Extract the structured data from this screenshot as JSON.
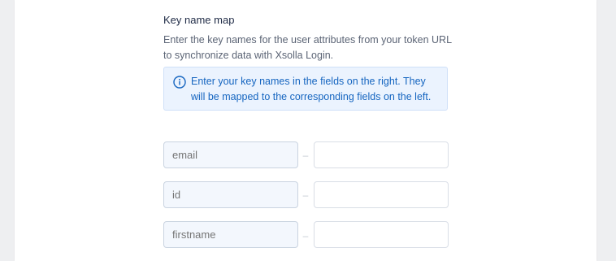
{
  "section": {
    "title": "Key name map",
    "description": "Enter the key names for the user attributes from your token URL to synchronize data with Xsolla Login."
  },
  "info": {
    "icon": "info-icon",
    "text": "Enter your key names in the fields on the right. They will be mapped to the corresponding fields on the left."
  },
  "mappings": [
    {
      "source": "email",
      "target": "",
      "separator": "–"
    },
    {
      "source": "id",
      "target": "",
      "separator": "–"
    },
    {
      "source": "firstname",
      "target": "",
      "separator": "–"
    }
  ],
  "colors": {
    "info_accent": "#1565c0",
    "info_background": "#ebf3fe"
  }
}
